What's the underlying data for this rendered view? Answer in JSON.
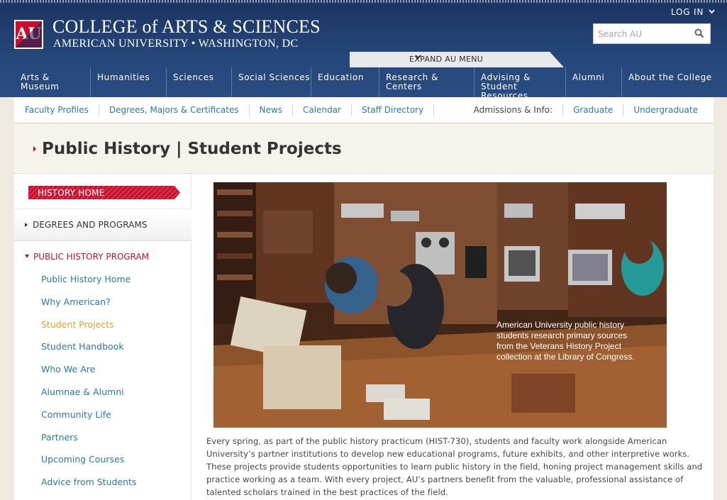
{
  "header": {
    "college_title": "COLLEGE of ARTS & SCIENCES",
    "college_subtitle": "AMERICAN UNIVERSITY • WASHINGTON, DC",
    "logo_letters": "AU",
    "login_label": "LOG IN",
    "search_placeholder": "Search AU",
    "expand_menu_label": "EXPAND AU MENU"
  },
  "main_nav": [
    {
      "label": "Arts & Museum"
    },
    {
      "label": "Humanities"
    },
    {
      "label": "Sciences"
    },
    {
      "label": "Social Sciences"
    },
    {
      "label": "Education"
    },
    {
      "label": "Research & Centers"
    },
    {
      "label": "Advising & Student Resources"
    },
    {
      "label": "Alumni"
    },
    {
      "label": "About the College"
    }
  ],
  "sub_nav": {
    "links": [
      "Faculty Profiles",
      "Degrees, Majors & Certificates",
      "News",
      "Calendar",
      "Staff Directory"
    ],
    "admissions_label": "Admissions & Info:",
    "admissions_links": [
      "Graduate",
      "Undergraduate"
    ]
  },
  "page": {
    "title": "Public History | Student Projects"
  },
  "sidebar": {
    "history_home": "HISTORY HOME",
    "degrees": "DEGREES AND PROGRAMS",
    "program": "PUBLIC HISTORY PROGRAM",
    "links": [
      {
        "label": "Public History Home"
      },
      {
        "label": "Why American?"
      },
      {
        "label": "Student Projects"
      },
      {
        "label": "Student Handbook"
      },
      {
        "label": "Who We Are"
      },
      {
        "label": "Alumnae & Alumni"
      },
      {
        "label": "Community Life"
      },
      {
        "label": "Partners"
      },
      {
        "label": "Upcoming Courses"
      },
      {
        "label": "Advice from Students"
      }
    ]
  },
  "main": {
    "photo_caption": "American University public history students research primary sources from the Veterans History Project collection at the Library of Congress.",
    "body": "Every spring, as part of the public history practicum (HIST-730), students and faculty work alongside American University’s partner institutions to develop new educational programs, future exhibits, and other interpretive works. These projects provide students opportunities to learn public history in the field, honing project management skills and practice working as a team. With every project, AU’s partners benefit from the valuable, professional assistance of talented scholars trained in the best practices of the field."
  },
  "colors": {
    "header_blue": "#26477b",
    "au_red": "#c8102e",
    "link_blue": "#2a78a8",
    "active_gold": "#e0a030"
  }
}
